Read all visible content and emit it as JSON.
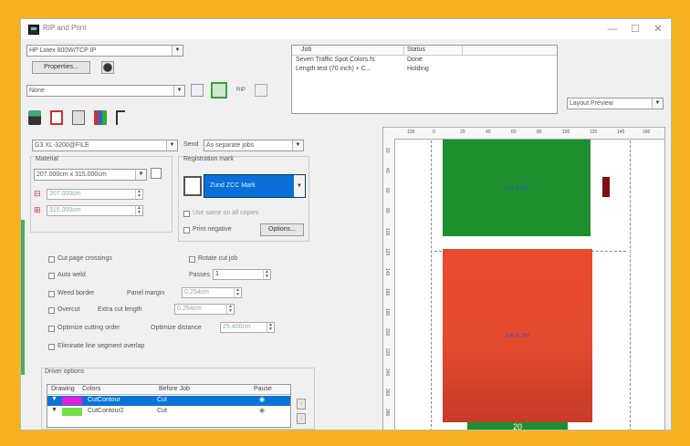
{
  "window": {
    "title": "RIP and Print",
    "min_symbol": "—",
    "max_symbol": "☐",
    "close_symbol": "✕"
  },
  "printer": {
    "device": "HP Latex 800W/TCP IP",
    "properties_label": "Properties...",
    "preset": "None"
  },
  "jobs": {
    "headers": {
      "job": "Job",
      "status": "Status"
    },
    "rows": [
      {
        "job": "Seven Traffic Spot Colors.fs",
        "status": "Done"
      },
      {
        "job": "Length test (70 inch) + C...",
        "status": "Holding"
      }
    ]
  },
  "layout_view": "Layout Preview",
  "settings": {
    "size_preset": "G3 XL-3200@FILE",
    "send_label": "Send",
    "send_value": "As separate jobs",
    "material_label": "Material",
    "material_value": "207.000cm x 315.000cm",
    "width_value": "207.000cm",
    "height_value": "315.000cm",
    "registration_label": "Registration mark",
    "registration_value": "Zund ZCC Mark",
    "use_same_label": "Use same on all copies",
    "print_negative_label": "Print negative",
    "options_label": "Options..."
  },
  "options": {
    "cut_page_crossings": "Cut page crossings",
    "rotate_cut_job": "Rotate cut job",
    "auto_weld": "Auto weld",
    "passes_label": "Passes",
    "passes_value": "1",
    "weed_border": "Weed border",
    "panel_margin_label": "Panel margin",
    "panel_margin_value": "0.254cm",
    "overcut": "Overcut",
    "extra_cut_length_label": "Extra cut length",
    "extra_cut_length_value": "0.254cm",
    "optimize_cutting_order": "Optimize cutting order",
    "optimize_distance_label": "Optimize distance",
    "optimize_distance_value": "25.400cm",
    "eliminate_overlap": "Eliminate line segment overlap"
  },
  "driver_options": {
    "title": "Driver options",
    "headers": {
      "drawing": "Drawing",
      "colors": "Colors",
      "before_job": "Before Job",
      "pause": "Pause"
    },
    "rows": [
      {
        "swatch": "#e51fd8",
        "color": "CutContour",
        "before": "Cut",
        "selected": true
      },
      {
        "swatch": "#76e04a",
        "color": "CutContour2",
        "before": "Cut",
        "selected": false
      }
    ]
  },
  "preview": {
    "top_ticks": [
      "100",
      "0",
      "20",
      "40",
      "60",
      "80",
      "100",
      "120",
      "140",
      "160"
    ],
    "left_ticks": [
      "20",
      "40",
      "60",
      "80",
      "100",
      "120",
      "140",
      "160",
      "180",
      "200",
      "220",
      "240",
      "260",
      "280"
    ],
    "tile1_label": "1m x 1m",
    "tile2_label": "1m x 2m",
    "tile3_label": "20",
    "colors": {
      "green": "#1e8f2e",
      "red_top": "#e84a2d",
      "red_bottom": "#c73a2a",
      "dark_red": "#7a0f15"
    }
  },
  "colors": {
    "border": "#f5b120",
    "accent": "#0078d7",
    "selected_row": "#0078d7"
  }
}
